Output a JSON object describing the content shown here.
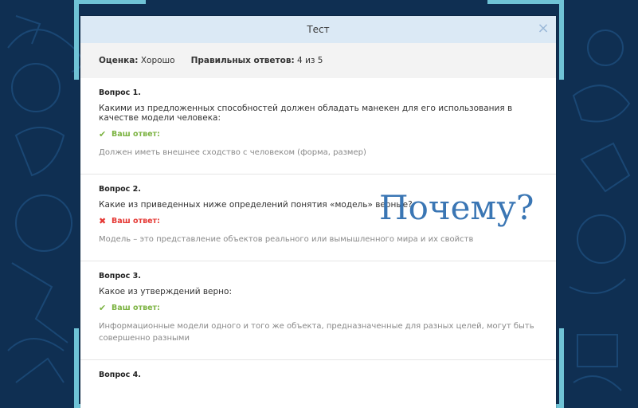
{
  "modal": {
    "title": "Тест",
    "close_glyph": "×"
  },
  "summary": {
    "grade_label": "Оценка:",
    "grade_value": "Хорошо",
    "correct_label": "Правильных ответов:",
    "correct_value": "4 из 5"
  },
  "questions": [
    {
      "number": "Вопрос 1.",
      "text": "Какими из предложенных способностей должен обладать манекен для его использования в качестве модели человека:",
      "answer_label": "Ваш ответ:",
      "status": "correct",
      "answer": "Должен иметь внешнее сходство с человеком (форма, размер)"
    },
    {
      "number": "Вопрос 2.",
      "text": "Какие из приведенных ниже определений понятия «модель» верные?",
      "answer_label": "Ваш ответ:",
      "status": "incorrect",
      "answer": "Модель – это представление объектов реального или вымышленного мира и их свойств"
    },
    {
      "number": "Вопрос 3.",
      "text": "Какое из утверждений верно:",
      "answer_label": "Ваш ответ:",
      "status": "correct",
      "answer": "Информационные модели одного и того же объекта, предназначенные для разных целей, могут быть совершенно разными"
    },
    {
      "number": "Вопрос 4."
    }
  ],
  "overlay": {
    "text": "Почему?"
  },
  "icons": {
    "correct": "check-icon",
    "incorrect": "cross-icon"
  },
  "colors": {
    "background": "#0f2f52",
    "header": "#dbe9f5",
    "accent_bracket": "#6fc3d6",
    "correct": "#7cb342",
    "incorrect": "#e53935",
    "overlay_text": "#3a76b4"
  }
}
